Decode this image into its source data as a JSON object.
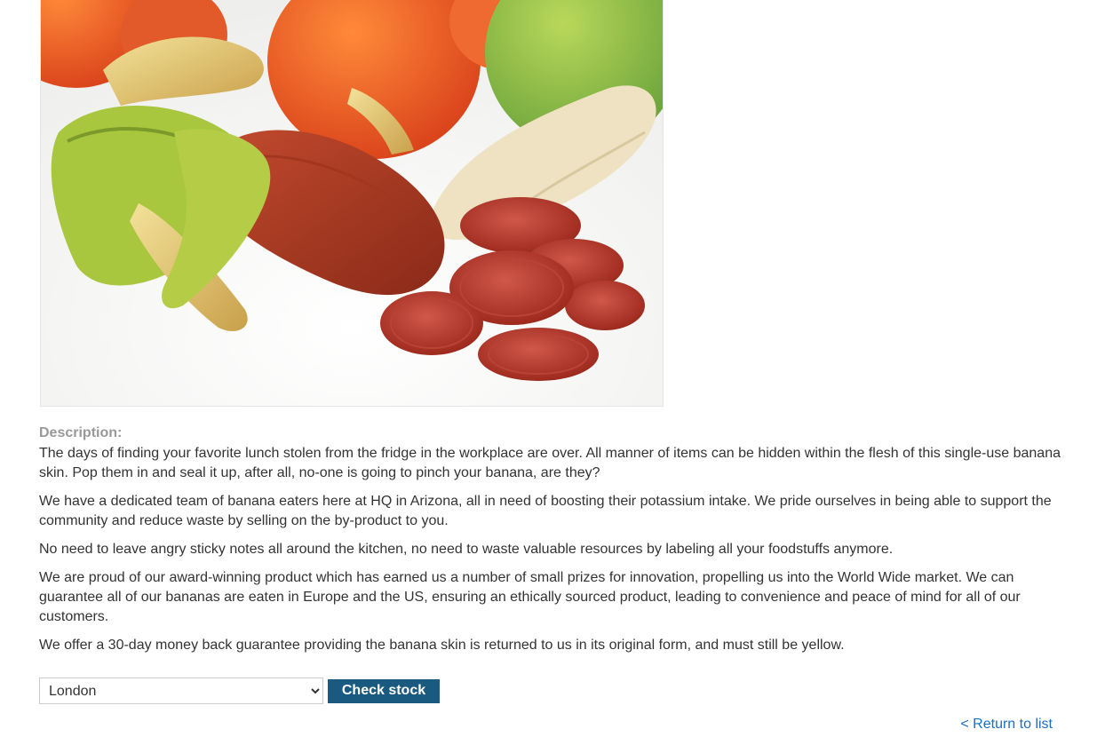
{
  "product": {
    "image_icon": "product-photo"
  },
  "description": {
    "label": "Description:",
    "paragraphs": [
      "The days of finding your favorite lunch stolen from the fridge in the workplace are over. All manner of items can be hidden within the flesh of this single-use banana skin. Pop them in and seal it up, after all, no-one is going to pinch your banana, are they?",
      "We have a dedicated team of banana eaters here at HQ in Arizona, all in need of boosting their potassium intake. We pride ourselves in being able to support the community and reduce waste by selling on the by-product to you.",
      "No need to leave angry sticky notes all around the kitchen, no need to waste valuable resources by labeling all your foodstuffs anymore.",
      "We are proud of our award-winning product which has earned us a number of small prizes for innovation, propelling us into the World Wide market. We can guarantee all of our bananas are eaten in Europe and the US, ensuring an ethically sourced product, leading to convenience and peace of mind for all of our customers.",
      "We offer a 30-day money back guarantee providing the banana skin is returned to us in its original form, and must still be yellow."
    ]
  },
  "stock": {
    "selected_store": "London",
    "button_label": "Check stock"
  },
  "nav": {
    "return_label": "< Return to list"
  },
  "colors": {
    "button_bg": "#1a5a80",
    "link": "#1a6fc2",
    "label": "#999999"
  }
}
